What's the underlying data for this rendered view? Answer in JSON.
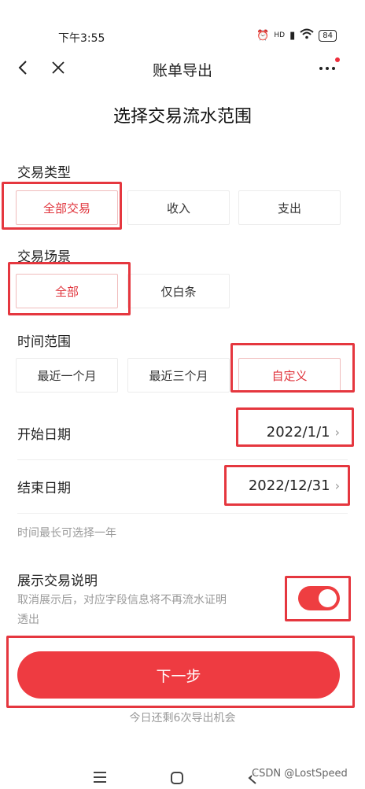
{
  "status_bar": {
    "time": "下午3:55",
    "network": "HD",
    "battery": "84"
  },
  "nav": {
    "title": "账单导出"
  },
  "heading": "选择交易流水范围",
  "transaction_type": {
    "label": "交易类型",
    "options": [
      "全部交易",
      "收入",
      "支出"
    ],
    "selected": "全部交易"
  },
  "transaction_scene": {
    "label": "交易场景",
    "options": [
      "全部",
      "仅白条"
    ],
    "selected": "全部"
  },
  "time_range": {
    "label": "时间范围",
    "options": [
      "最近一个月",
      "最近三个月",
      "自定义"
    ],
    "selected": "自定义"
  },
  "start_date": {
    "label": "开始日期",
    "value": "2022/1/1"
  },
  "end_date": {
    "label": "结束日期",
    "value": "2022/12/31"
  },
  "range_hint": "时间最长可选择一年",
  "show_description": {
    "label": "展示交易说明",
    "hint_line1": "取消展示后，对应字段信息将不再流水证明",
    "hint_line2": "透出",
    "enabled": true
  },
  "next_button": "下一步",
  "remaining_text": "今日还剩6次导出机会",
  "watermark": "CSDN @LostSpeed",
  "colors": {
    "accent": "#ee3b41",
    "annotation": "#e5373f"
  }
}
